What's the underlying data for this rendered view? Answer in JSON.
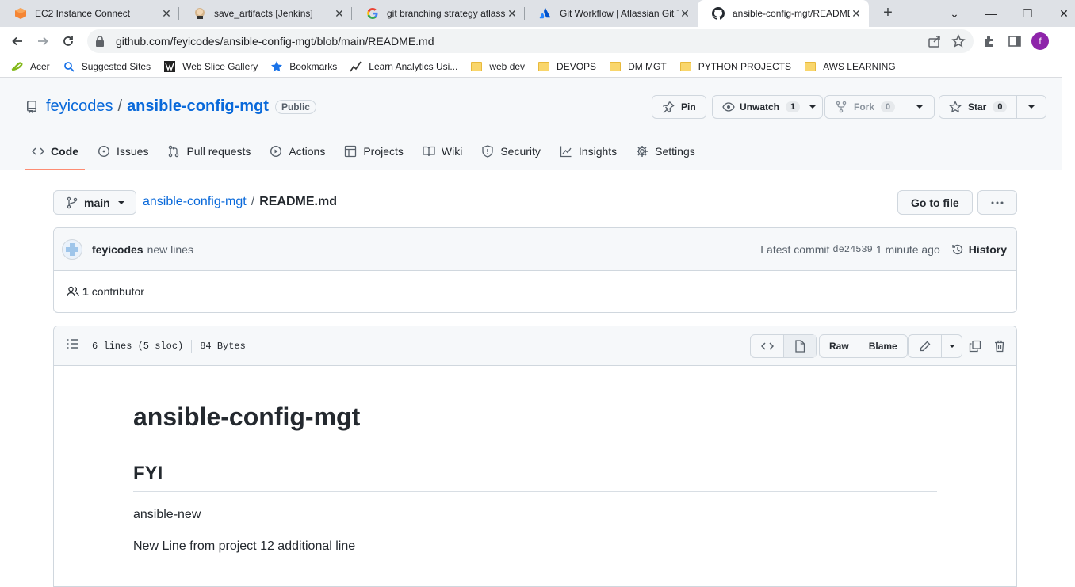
{
  "browser": {
    "tabs": [
      {
        "title": "EC2 Instance Connect",
        "icon": "aws-ec2-icon"
      },
      {
        "title": "save_artifacts [Jenkins]",
        "icon": "jenkins-icon"
      },
      {
        "title": "git branching strategy atlassian",
        "icon": "google-icon"
      },
      {
        "title": "Git Workflow | Atlassian Git Tutorial",
        "icon": "atlassian-icon"
      },
      {
        "title": "ansible-config-mgt/README.md",
        "icon": "github-icon",
        "active": true
      }
    ],
    "url": "github.com/feyicodes/ansible-config-mgt/blob/main/README.md",
    "profile_initial": "f",
    "bookmarks": [
      {
        "label": "Acer"
      },
      {
        "label": "Suggested Sites"
      },
      {
        "label": "Web Slice Gallery"
      },
      {
        "label": "Bookmarks"
      },
      {
        "label": "Learn Analytics Usi..."
      },
      {
        "label": "web dev"
      },
      {
        "label": "DEVOPS"
      },
      {
        "label": "DM MGT"
      },
      {
        "label": "PYTHON PROJECTS"
      },
      {
        "label": "AWS LEARNING"
      }
    ]
  },
  "repo": {
    "owner": "feyicodes",
    "name": "ansible-config-mgt",
    "visibility": "Public",
    "pin_label": "Pin",
    "watch_label": "Unwatch",
    "watch_count": "1",
    "fork_label": "Fork",
    "fork_count": "0",
    "star_label": "Star",
    "star_count": "0",
    "nav": [
      {
        "label": "Code",
        "selected": true
      },
      {
        "label": "Issues"
      },
      {
        "label": "Pull requests"
      },
      {
        "label": "Actions"
      },
      {
        "label": "Projects"
      },
      {
        "label": "Wiki"
      },
      {
        "label": "Security"
      },
      {
        "label": "Insights"
      },
      {
        "label": "Settings"
      }
    ]
  },
  "file": {
    "branch": "main",
    "path_repo": "ansible-config-mgt",
    "path_file": "README.md",
    "go_to_file": "Go to file",
    "commit_author": "feyicodes",
    "commit_message": "new lines",
    "latest_commit_label": "Latest commit",
    "commit_sha": "de24539",
    "commit_time": "1 minute ago",
    "history_label": "History",
    "contributor_count": "1",
    "contributor_label": "contributor",
    "lines_info": "6 lines (5 sloc)",
    "size_info": "84 Bytes",
    "raw_label": "Raw",
    "blame_label": "Blame"
  },
  "readme": {
    "h1": "ansible-config-mgt",
    "h2": "FYI",
    "p1": "ansible-new",
    "p2": "New Line from project 12 additional line"
  },
  "colors": {
    "link": "#0969da",
    "nav_underline": "#fd8c73",
    "header_bg": "#f6f8fa",
    "border": "#d0d7de"
  }
}
